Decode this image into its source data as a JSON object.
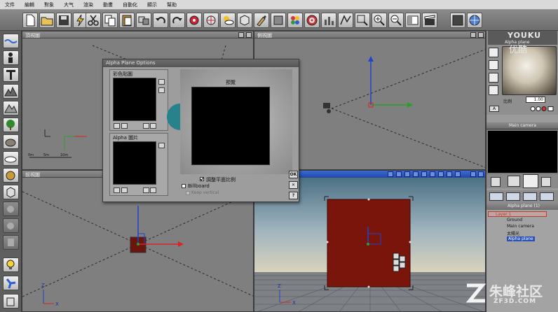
{
  "menu": [
    "文件",
    "編輯",
    "對象",
    "大气",
    "渲染",
    "動畫",
    "自動化",
    "顯示",
    "幫助"
  ],
  "viewports": {
    "top": {
      "title": "頂視圖",
      "scale": [
        "0m",
        "5m",
        "10m"
      ]
    },
    "side": {
      "title": "側視圖"
    },
    "front": {
      "title": "前視圖",
      "axis_x": "X",
      "axis_z": "Z"
    },
    "perspective": {
      "axis_x": "X",
      "axis_z": "Z"
    }
  },
  "dialog": {
    "title": "Alpha Plane Options",
    "color_map_label": "彩色貼圖",
    "alpha_map_label": "Alpha 圖片",
    "preview_label": "預覽",
    "adjust_ratio_label": "調整平面比例",
    "adjust_ratio_checked": true,
    "billboard_label": "Billboard",
    "billboard_checked": false,
    "keep_vertical_label": "Keep vertical",
    "keep_vertical_checked": false,
    "ok_label": "OK",
    "close_label": "✕",
    "help_label": "?"
  },
  "right_panel": {
    "material_name": "Alpha plane",
    "scale_label": "比例",
    "scale_value": "1.00",
    "camera_label": "Main camera",
    "object_label": "Alpha plane (1)",
    "tree": [
      {
        "label": "Layer 1",
        "color": "#c0392b"
      },
      {
        "label": "Ground",
        "color": "#111111"
      },
      {
        "label": "Main camera",
        "color": "#111111"
      },
      {
        "label": "太陽光",
        "color": "#111111"
      },
      {
        "label": "Alpha plane",
        "color": "#ffffff"
      }
    ]
  },
  "watermarks": {
    "youku": "YOUKU",
    "youku_cn": "优酷",
    "site_cn": "朱峰社区",
    "site_url": "ZF3D.COM"
  },
  "colors": {
    "accent": "#2a50b8",
    "plane": "#7a150c",
    "cursor_highlight": "#1b7f8a"
  }
}
